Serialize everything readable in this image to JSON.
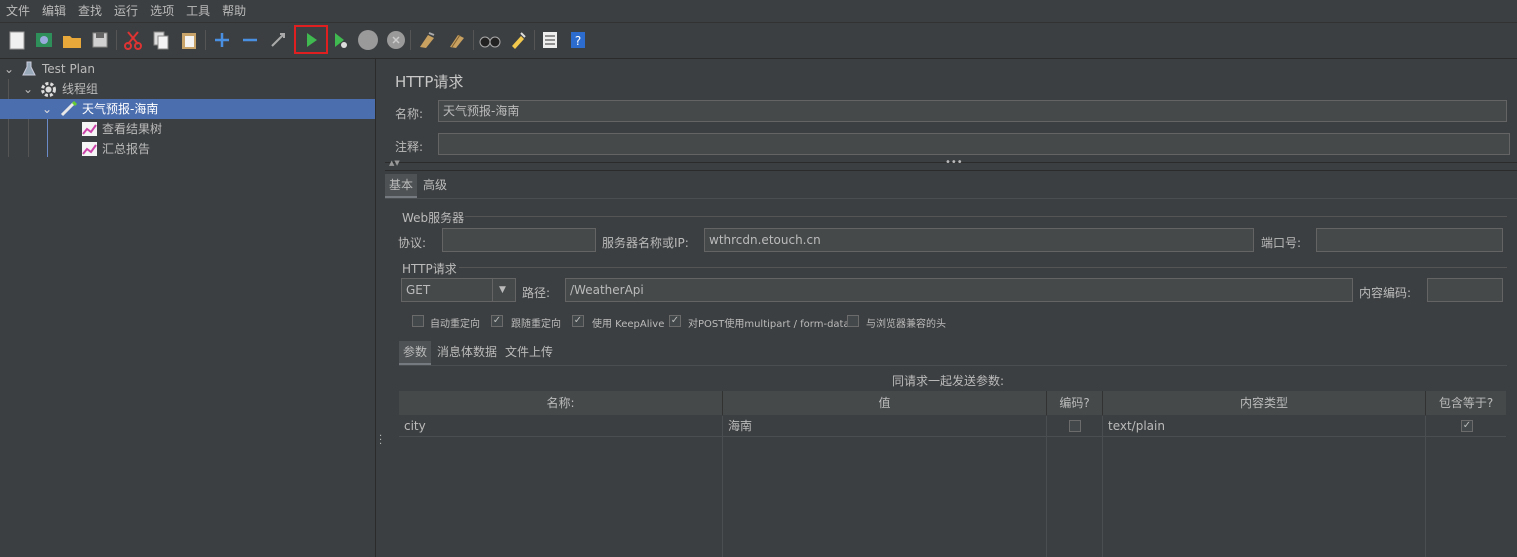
{
  "menu": [
    "文件",
    "编辑",
    "查找",
    "运行",
    "选项",
    "工具",
    "帮助"
  ],
  "toolbar": {
    "buttons": [
      "new-icon",
      "templates-icon",
      "open-icon",
      "save-icon",
      "cut-icon",
      "copy-icon",
      "paste-icon",
      "expand-icon",
      "collapse-icon",
      "toggle-icon",
      "start-icon",
      "start-no-pause-icon",
      "stop-icon",
      "shutdown-icon",
      "clear-icon",
      "clear-all-icon",
      "search-icon",
      "reset-search-icon",
      "function-helper-icon",
      "help-icon"
    ]
  },
  "tree": {
    "test_plan": "Test Plan",
    "thread_group": "线程组",
    "sampler": "天气预报-海南",
    "listener1": "查看结果树",
    "listener2": "汇总报告"
  },
  "panel": {
    "title": "HTTP请求",
    "name_label": "名称:",
    "name_value": "天气预报-海南",
    "comment_label": "注释:",
    "comment_value": "",
    "tabs": [
      "基本",
      "高级"
    ],
    "web_server_group": "Web服务器",
    "protocol_label": "协议:",
    "protocol_value": "",
    "server_label": "服务器名称或IP:",
    "server_value": "wthrcdn.etouch.cn",
    "port_label": "端口号:",
    "port_value": "",
    "http_group": "HTTP请求",
    "method": "GET",
    "path_label": "路径:",
    "path_value": "/WeatherApi",
    "encoding_label": "内容编码:",
    "encoding_value": "",
    "checkboxes": [
      {
        "label": "自动重定向",
        "checked": false,
        "mark": ""
      },
      {
        "label": "跟随重定向",
        "checked": true,
        "mark": "✓"
      },
      {
        "label": "使用 KeepAlive",
        "checked": true,
        "mark": "✓"
      },
      {
        "label": "对POST使用multipart / form-data",
        "checked": true,
        "mark": "✓"
      },
      {
        "label": "与浏览器兼容的头",
        "checked": false,
        "mark": ""
      }
    ],
    "sub_tabs": [
      "参数",
      "消息体数据",
      "文件上传"
    ],
    "params_caption": "同请求一起发送参数:"
  },
  "table": {
    "headers": [
      "名称:",
      "值",
      "编码?",
      "内容类型",
      "包含等于?"
    ],
    "rows": [
      {
        "name": "city",
        "value": "海南",
        "encode": "",
        "content_type": "text/plain",
        "include_equals": "✓"
      }
    ]
  },
  "colors": {
    "selection": "#4b6eaf",
    "run_highlight": "#e02020",
    "run_green": "#3fb950"
  }
}
